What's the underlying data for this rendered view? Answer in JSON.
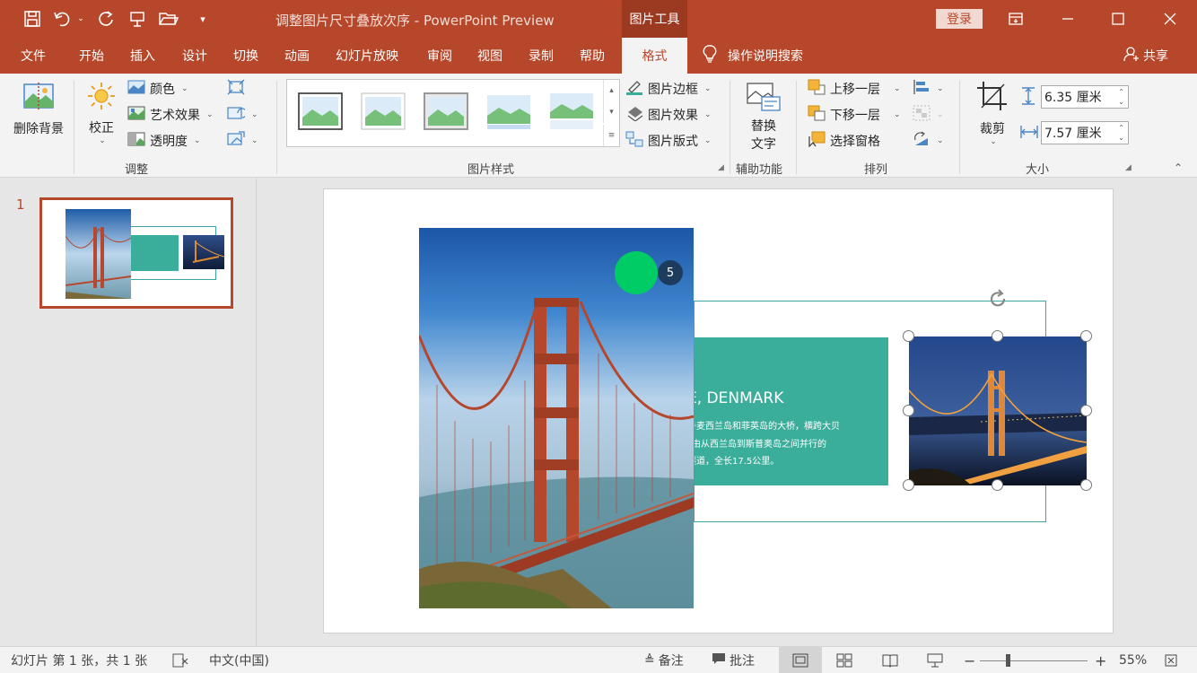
{
  "titlebar": {
    "doc_title": "调整图片尺寸叠放次序 - PowerPoint Preview",
    "picture_tools": "图片工具",
    "login": "登录",
    "icons": [
      "save-icon",
      "undo-icon",
      "redo-icon",
      "present-icon",
      "open-folder-icon",
      "customize-qat-icon"
    ]
  },
  "menu": {
    "tabs": [
      "文件",
      "开始",
      "插入",
      "设计",
      "切换",
      "动画",
      "幻灯片放映",
      "审阅",
      "视图",
      "录制",
      "帮助",
      "格式"
    ],
    "active_tab": "格式",
    "tell_me": "操作说明搜索",
    "share": "共享"
  },
  "ribbon": {
    "adjust": {
      "remove_bg": "删除背景",
      "corrections": "校正",
      "color": "颜色",
      "artistic": "艺术效果",
      "transparency": "透明度",
      "label": "调整"
    },
    "styles": {
      "border": "图片边框",
      "effects": "图片效果",
      "layout": "图片版式",
      "label": "图片样式"
    },
    "accessibility": {
      "alt_text_line1": "替换",
      "alt_text_line2": "文字",
      "label": "辅助功能"
    },
    "arrange": {
      "bring_forward": "上移一层",
      "send_backward": "下移一层",
      "selection_pane": "选择窗格",
      "label": "排列"
    },
    "size": {
      "crop": "裁剪",
      "height": "6.35 厘米",
      "width": "7.57 厘米",
      "label": "大小"
    }
  },
  "thumbnails": {
    "slide_number": "1"
  },
  "slide": {
    "teal_title": "E, DENMARK",
    "teal_lines": [
      "丹麦西兰岛和菲英岛的大桥，横跨大贝",
      "由从西兰岛到斯普奥岛之间并行的",
      "隧道，全长17.5公里。"
    ],
    "badge": "5"
  },
  "status": {
    "slide_info": "幻灯片 第 1 张，共 1 张",
    "language": "中文(中国)",
    "notes": "备注",
    "comments": "批注",
    "zoom": "55%"
  },
  "colors": {
    "brand": "#b7472a",
    "teal": "#3aae9a",
    "badge": "#1d3b5c",
    "green_dot": "#00cc66"
  }
}
